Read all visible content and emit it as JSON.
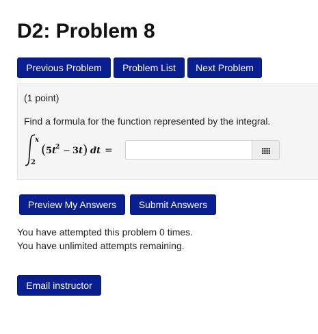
{
  "page": {
    "title": "D2: Problem 8"
  },
  "nav": {
    "previous_label": "Previous Problem",
    "list_label": "Problem List",
    "next_label": "Next Problem"
  },
  "problem": {
    "points": "(1 point)",
    "question": "Find a formula for the function represented by the integral.",
    "formula": {
      "upper_limit": "x",
      "lower_limit": "2",
      "integrand": "(5t² − 3t) dt =",
      "integrand_parts": {
        "open_paren": "(",
        "coeff": "5",
        "var": "t",
        "exponent": "2",
        "minus": "−",
        "term2": "3",
        "var2": "t",
        "close_paren": ")",
        "differential": "dt",
        "equals": "="
      }
    },
    "answer_value": "",
    "answer_placeholder": ""
  },
  "actions": {
    "preview_label": "Preview My Answers",
    "submit_label": "Submit Answers"
  },
  "status": {
    "attempts_line": "You have attempted this problem 0 times.",
    "remaining_line": "You have unlimited attempts remaining."
  },
  "footer": {
    "email_label": "Email instructor"
  },
  "colors": {
    "button_bg": "#0a1f8f",
    "problem_bg": "#f5f5f5"
  },
  "icons": {
    "palette": "grid-icon"
  }
}
